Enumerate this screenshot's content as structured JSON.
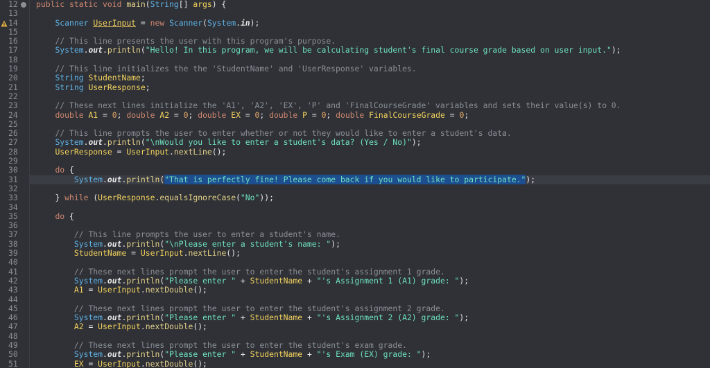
{
  "editor": {
    "lines": [
      {
        "n": "12",
        "tokens": [
          {
            "t": "public static void ",
            "c": "kw"
          },
          {
            "t": "main",
            "c": "mth"
          },
          {
            "t": "(",
            "c": "sym"
          },
          {
            "t": "String",
            "c": "ty"
          },
          {
            "t": "[] ",
            "c": "sym"
          },
          {
            "t": "args",
            "c": "var"
          },
          {
            "t": ") {",
            "c": "sym"
          }
        ],
        "indent": "",
        "fold": true
      },
      {
        "n": "13",
        "tokens": [],
        "indent": "    "
      },
      {
        "n": "14",
        "tokens": [
          {
            "t": "Scanner ",
            "c": "ty"
          },
          {
            "t": "UserInput",
            "c": "var",
            "w": true
          },
          {
            "t": " = ",
            "c": "sym"
          },
          {
            "t": "new ",
            "c": "kw"
          },
          {
            "t": "Scanner",
            "c": "ty"
          },
          {
            "t": "(",
            "c": "sym"
          },
          {
            "t": "System",
            "c": "ty"
          },
          {
            "t": ".",
            "c": "sym"
          },
          {
            "t": "in",
            "c": "fld"
          },
          {
            "t": ");",
            "c": "sym"
          }
        ],
        "indent": "    ",
        "warn": true
      },
      {
        "n": "15",
        "tokens": [],
        "indent": "    "
      },
      {
        "n": "16",
        "tokens": [
          {
            "t": "// This line presents the user with this program's purpose.",
            "c": "cmt"
          }
        ],
        "indent": "    "
      },
      {
        "n": "17",
        "tokens": [
          {
            "t": "System",
            "c": "ty"
          },
          {
            "t": ".",
            "c": "sym"
          },
          {
            "t": "out",
            "c": "fld"
          },
          {
            "t": ".",
            "c": "sym"
          },
          {
            "t": "println",
            "c": "mth"
          },
          {
            "t": "(",
            "c": "sym"
          },
          {
            "t": "\"Hello! In this program, we will be calculating student's final course grade based on user input.\"",
            "c": "str"
          },
          {
            "t": ");",
            "c": "sym"
          }
        ],
        "indent": "    "
      },
      {
        "n": "18",
        "tokens": [],
        "indent": "    "
      },
      {
        "n": "19",
        "tokens": [
          {
            "t": "// This line initializes the the 'StudentName' and 'UserResponse' variables.",
            "c": "cmt"
          }
        ],
        "indent": "    "
      },
      {
        "n": "20",
        "tokens": [
          {
            "t": "String ",
            "c": "ty"
          },
          {
            "t": "StudentName",
            "c": "var"
          },
          {
            "t": ";",
            "c": "sym"
          }
        ],
        "indent": "    "
      },
      {
        "n": "21",
        "tokens": [
          {
            "t": "String ",
            "c": "ty"
          },
          {
            "t": "UserResponse",
            "c": "var"
          },
          {
            "t": ";",
            "c": "sym"
          }
        ],
        "indent": "    "
      },
      {
        "n": "22",
        "tokens": [],
        "indent": "    "
      },
      {
        "n": "23",
        "tokens": [
          {
            "t": "// These next lines initialize the 'A1', 'A2', 'EX', 'P' and 'FinalCourseGrade' variables and sets their value(s) to 0.",
            "c": "cmt"
          }
        ],
        "indent": "    "
      },
      {
        "n": "24",
        "tokens": [
          {
            "t": "double ",
            "c": "kw"
          },
          {
            "t": "A1",
            "c": "var"
          },
          {
            "t": " = ",
            "c": "sym"
          },
          {
            "t": "0",
            "c": "num-lit"
          },
          {
            "t": "; ",
            "c": "sym"
          },
          {
            "t": "double ",
            "c": "kw"
          },
          {
            "t": "A2",
            "c": "var"
          },
          {
            "t": " = ",
            "c": "sym"
          },
          {
            "t": "0",
            "c": "num-lit"
          },
          {
            "t": "; ",
            "c": "sym"
          },
          {
            "t": "double ",
            "c": "kw"
          },
          {
            "t": "EX",
            "c": "var"
          },
          {
            "t": " = ",
            "c": "sym"
          },
          {
            "t": "0",
            "c": "num-lit"
          },
          {
            "t": "; ",
            "c": "sym"
          },
          {
            "t": "double ",
            "c": "kw"
          },
          {
            "t": "P",
            "c": "var"
          },
          {
            "t": " = ",
            "c": "sym"
          },
          {
            "t": "0",
            "c": "num-lit"
          },
          {
            "t": "; ",
            "c": "sym"
          },
          {
            "t": "double ",
            "c": "kw"
          },
          {
            "t": "FinalCourseGrade",
            "c": "var"
          },
          {
            "t": " = ",
            "c": "sym"
          },
          {
            "t": "0",
            "c": "num-lit"
          },
          {
            "t": ";",
            "c": "sym"
          }
        ],
        "indent": "    "
      },
      {
        "n": "25",
        "tokens": [],
        "indent": "    "
      },
      {
        "n": "26",
        "tokens": [
          {
            "t": "// This line prompts the user to enter whether or not they would like to enter a student's data.",
            "c": "cmt"
          }
        ],
        "indent": "    "
      },
      {
        "n": "27",
        "tokens": [
          {
            "t": "System",
            "c": "ty"
          },
          {
            "t": ".",
            "c": "sym"
          },
          {
            "t": "out",
            "c": "fld"
          },
          {
            "t": ".",
            "c": "sym"
          },
          {
            "t": "println",
            "c": "mth"
          },
          {
            "t": "(",
            "c": "sym"
          },
          {
            "t": "\"\\nWould you like to enter a student's data? (Yes / No)\"",
            "c": "str"
          },
          {
            "t": ");",
            "c": "sym"
          }
        ],
        "indent": "    "
      },
      {
        "n": "28",
        "tokens": [
          {
            "t": "UserResponse",
            "c": "var"
          },
          {
            "t": " = ",
            "c": "sym"
          },
          {
            "t": "UserInput",
            "c": "var"
          },
          {
            "t": ".",
            "c": "sym"
          },
          {
            "t": "nextLine",
            "c": "mth"
          },
          {
            "t": "();",
            "c": "sym"
          }
        ],
        "indent": "    "
      },
      {
        "n": "29",
        "tokens": [],
        "indent": "    "
      },
      {
        "n": "30",
        "tokens": [
          {
            "t": "do ",
            "c": "kw"
          },
          {
            "t": "{",
            "c": "sym"
          }
        ],
        "indent": "    "
      },
      {
        "n": "31",
        "tokens": [
          {
            "t": "System",
            "c": "ty"
          },
          {
            "t": ".",
            "c": "sym"
          },
          {
            "t": "out",
            "c": "fld"
          },
          {
            "t": ".",
            "c": "sym"
          },
          {
            "t": "println",
            "c": "mth"
          },
          {
            "t": "(",
            "c": "sym"
          },
          {
            "t": "\"That is perfectly fine! Please come back if you would like to participate.\"",
            "c": "str",
            "sel": true
          },
          {
            "t": ");",
            "c": "sym"
          }
        ],
        "indent": "        ",
        "current": true
      },
      {
        "n": "32",
        "tokens": [],
        "indent": "    "
      },
      {
        "n": "33",
        "tokens": [
          {
            "t": "} ",
            "c": "sym"
          },
          {
            "t": "while ",
            "c": "kw"
          },
          {
            "t": "(",
            "c": "sym"
          },
          {
            "t": "UserResponse",
            "c": "var"
          },
          {
            "t": ".",
            "c": "sym"
          },
          {
            "t": "equalsIgnoreCase",
            "c": "mth"
          },
          {
            "t": "(",
            "c": "sym"
          },
          {
            "t": "\"No\"",
            "c": "str"
          },
          {
            "t": "));",
            "c": "sym"
          }
        ],
        "indent": "    "
      },
      {
        "n": "34",
        "tokens": [],
        "indent": "    "
      },
      {
        "n": "35",
        "tokens": [
          {
            "t": "do ",
            "c": "kw"
          },
          {
            "t": "{",
            "c": "sym"
          }
        ],
        "indent": "    "
      },
      {
        "n": "36",
        "tokens": [],
        "indent": "    "
      },
      {
        "n": "37",
        "tokens": [
          {
            "t": "// This line prompts the user to enter a student's name.",
            "c": "cmt"
          }
        ],
        "indent": "        "
      },
      {
        "n": "38",
        "tokens": [
          {
            "t": "System",
            "c": "ty"
          },
          {
            "t": ".",
            "c": "sym"
          },
          {
            "t": "out",
            "c": "fld"
          },
          {
            "t": ".",
            "c": "sym"
          },
          {
            "t": "println",
            "c": "mth"
          },
          {
            "t": "(",
            "c": "sym"
          },
          {
            "t": "\"\\nPlease enter a student's name: \"",
            "c": "str"
          },
          {
            "t": ");",
            "c": "sym"
          }
        ],
        "indent": "        "
      },
      {
        "n": "39",
        "tokens": [
          {
            "t": "StudentName",
            "c": "var"
          },
          {
            "t": " = ",
            "c": "sym"
          },
          {
            "t": "UserInput",
            "c": "var"
          },
          {
            "t": ".",
            "c": "sym"
          },
          {
            "t": "nextLine",
            "c": "mth"
          },
          {
            "t": "();",
            "c": "sym"
          }
        ],
        "indent": "        "
      },
      {
        "n": "40",
        "tokens": [],
        "indent": "    "
      },
      {
        "n": "41",
        "tokens": [
          {
            "t": "// These next lines prompt the user to enter the student's assignment 1 grade.",
            "c": "cmt"
          }
        ],
        "indent": "        "
      },
      {
        "n": "42",
        "tokens": [
          {
            "t": "System",
            "c": "ty"
          },
          {
            "t": ".",
            "c": "sym"
          },
          {
            "t": "out",
            "c": "fld"
          },
          {
            "t": ".",
            "c": "sym"
          },
          {
            "t": "println",
            "c": "mth"
          },
          {
            "t": "(",
            "c": "sym"
          },
          {
            "t": "\"Please enter \"",
            "c": "str"
          },
          {
            "t": " + ",
            "c": "sym"
          },
          {
            "t": "StudentName",
            "c": "var"
          },
          {
            "t": " + ",
            "c": "sym"
          },
          {
            "t": "\"'s Assignment 1 (A1) grade: \"",
            "c": "str"
          },
          {
            "t": ");",
            "c": "sym"
          }
        ],
        "indent": "        "
      },
      {
        "n": "43",
        "tokens": [
          {
            "t": "A1",
            "c": "var"
          },
          {
            "t": " = ",
            "c": "sym"
          },
          {
            "t": "UserInput",
            "c": "var"
          },
          {
            "t": ".",
            "c": "sym"
          },
          {
            "t": "nextDouble",
            "c": "mth"
          },
          {
            "t": "();",
            "c": "sym"
          }
        ],
        "indent": "        "
      },
      {
        "n": "44",
        "tokens": [],
        "indent": "    "
      },
      {
        "n": "45",
        "tokens": [
          {
            "t": "// These next lines prompt the user to enter the student's assignment 2 grade.",
            "c": "cmt"
          }
        ],
        "indent": "        "
      },
      {
        "n": "46",
        "tokens": [
          {
            "t": "System",
            "c": "ty"
          },
          {
            "t": ".",
            "c": "sym"
          },
          {
            "t": "out",
            "c": "fld"
          },
          {
            "t": ".",
            "c": "sym"
          },
          {
            "t": "println",
            "c": "mth"
          },
          {
            "t": "(",
            "c": "sym"
          },
          {
            "t": "\"Please enter \"",
            "c": "str"
          },
          {
            "t": " + ",
            "c": "sym"
          },
          {
            "t": "StudentName",
            "c": "var"
          },
          {
            "t": " + ",
            "c": "sym"
          },
          {
            "t": "\"'s Assignment 2 (A2) grade: \"",
            "c": "str"
          },
          {
            "t": ");",
            "c": "sym"
          }
        ],
        "indent": "        "
      },
      {
        "n": "47",
        "tokens": [
          {
            "t": "A2",
            "c": "var"
          },
          {
            "t": " = ",
            "c": "sym"
          },
          {
            "t": "UserInput",
            "c": "var"
          },
          {
            "t": ".",
            "c": "sym"
          },
          {
            "t": "nextDouble",
            "c": "mth"
          },
          {
            "t": "();",
            "c": "sym"
          }
        ],
        "indent": "        "
      },
      {
        "n": "48",
        "tokens": [],
        "indent": "    "
      },
      {
        "n": "49",
        "tokens": [
          {
            "t": "// These next lines prompt the user to enter the student's exam grade.",
            "c": "cmt"
          }
        ],
        "indent": "        "
      },
      {
        "n": "50",
        "tokens": [
          {
            "t": "System",
            "c": "ty"
          },
          {
            "t": ".",
            "c": "sym"
          },
          {
            "t": "out",
            "c": "fld"
          },
          {
            "t": ".",
            "c": "sym"
          },
          {
            "t": "println",
            "c": "mth"
          },
          {
            "t": "(",
            "c": "sym"
          },
          {
            "t": "\"Please enter \"",
            "c": "str"
          },
          {
            "t": " + ",
            "c": "sym"
          },
          {
            "t": "StudentName",
            "c": "var"
          },
          {
            "t": " + ",
            "c": "sym"
          },
          {
            "t": "\"'s Exam (EX) grade: \"",
            "c": "str"
          },
          {
            "t": ");",
            "c": "sym"
          }
        ],
        "indent": "        "
      },
      {
        "n": "51",
        "tokens": [
          {
            "t": "EX",
            "c": "var"
          },
          {
            "t": " = ",
            "c": "sym"
          },
          {
            "t": "UserInput",
            "c": "var"
          },
          {
            "t": ".",
            "c": "sym"
          },
          {
            "t": "nextDouble",
            "c": "mth"
          },
          {
            "t": "();",
            "c": "sym"
          }
        ],
        "indent": "        "
      }
    ]
  },
  "colors": {
    "background": "#2f3136",
    "current_line": "#3a3d44",
    "selection": "#1d4e8f",
    "keyword": "#d08770",
    "type": "#5fb3e8",
    "variable": "#f4d35e",
    "string": "#6ee2c0",
    "comment": "#8a8f96",
    "number": "#e6a96a"
  },
  "icons": {
    "fold_marker": "fold-collapse-icon",
    "warning_marker": "warning-icon"
  }
}
